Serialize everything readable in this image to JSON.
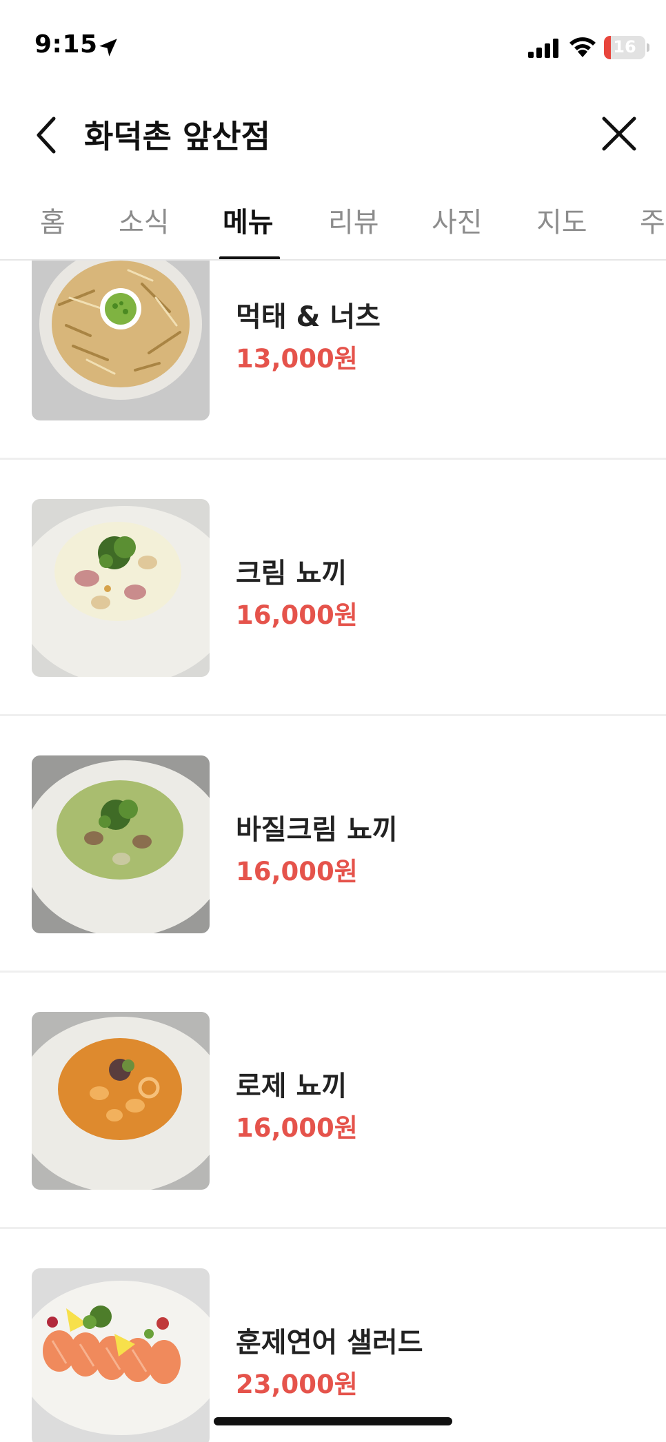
{
  "status_bar": {
    "time": "9:15",
    "battery_level": "16",
    "icons": [
      "location-arrow-icon",
      "cellular-signal-icon",
      "wifi-icon",
      "battery-icon"
    ]
  },
  "header": {
    "title": "화덕촌 앞산점",
    "back_icon": "chevron-left-icon",
    "close_icon": "close-icon"
  },
  "tabs": [
    {
      "label": "홈",
      "active": false
    },
    {
      "label": "소식",
      "active": false
    },
    {
      "label": "메뉴",
      "active": true
    },
    {
      "label": "리뷰",
      "active": false
    },
    {
      "label": "사진",
      "active": false
    },
    {
      "label": "지도",
      "active": false
    },
    {
      "label": "주",
      "active": false
    }
  ],
  "menu_items": [
    {
      "name": "먹태 & 너츠",
      "price": "13,000원",
      "image": "dried-pollack-snack-photo"
    },
    {
      "name": "크림 뇨끼",
      "price": "16,000원",
      "image": "cream-gnocchi-photo"
    },
    {
      "name": "바질크림 뇨끼",
      "price": "16,000원",
      "image": "basil-cream-gnocchi-photo"
    },
    {
      "name": "로제 뇨끼",
      "price": "16,000원",
      "image": "rose-gnocchi-photo"
    },
    {
      "name": "훈제연어 샐러드",
      "price": "23,000원",
      "image": "smoked-salmon-salad-photo"
    }
  ],
  "colors": {
    "price": "#e5534b",
    "active_tab": "#111111",
    "inactive_tab": "#8c8c8c",
    "battery_low": "#e8453c"
  }
}
